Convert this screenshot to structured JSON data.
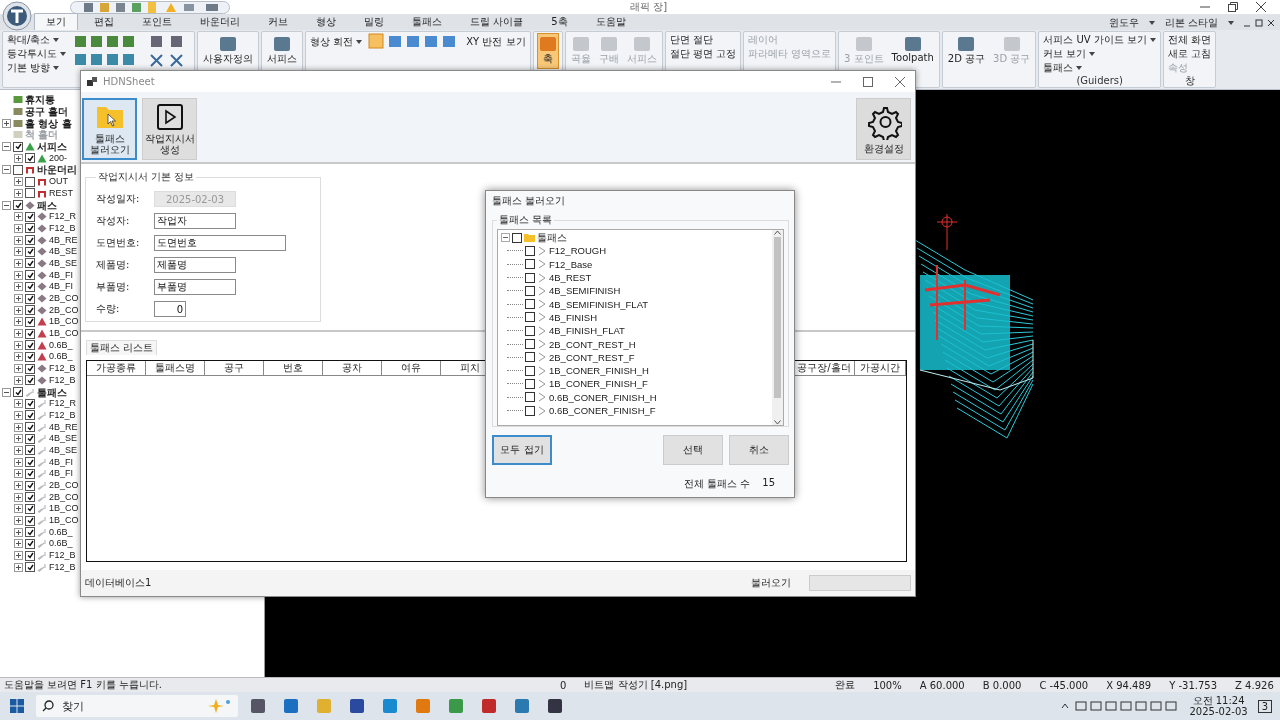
{
  "app": {
    "title_fragment": "래픽 장]"
  },
  "ribbon_tabs": [
    {
      "label": "보기",
      "selected": true
    },
    {
      "label": "편집",
      "selected": false
    },
    {
      "label": "포인트",
      "selected": false
    },
    {
      "label": "바운더리",
      "selected": false
    },
    {
      "label": "커브",
      "selected": false
    },
    {
      "label": "형상",
      "selected": false
    },
    {
      "label": "밀링",
      "selected": false
    },
    {
      "label": "툴패스",
      "selected": false
    },
    {
      "label": "드릴 사이클",
      "selected": false
    },
    {
      "label": "5축",
      "selected": false
    },
    {
      "label": "도움말",
      "selected": false
    }
  ],
  "ribbon_menu": [
    "윈도우",
    "리본 스타일"
  ],
  "ribbon_groups": [
    {
      "kind": "view",
      "items": [
        {
          "label": "확대/축소",
          "dropdown": true,
          "disabled": false
        },
        {
          "label": "등각투시도",
          "dropdown": true,
          "disabled": false
        },
        {
          "label": "기본 방향",
          "dropdown": true,
          "disabled": false
        }
      ]
    },
    {
      "kind": "large",
      "items": [
        {
          "label": "사용자정의",
          "disabled": false,
          "selected": false
        }
      ]
    },
    {
      "kind": "large",
      "items": [
        {
          "label": "서피스",
          "disabled": false,
          "selected": false
        }
      ]
    },
    {
      "kind": "rotate",
      "items": [
        {
          "label": "형상 회전",
          "dropdown": true,
          "disabled": false
        },
        {
          "label": "XY 반전 보기",
          "dropdown": false,
          "disabled": false
        }
      ]
    },
    {
      "kind": "large",
      "items": [
        {
          "label": "축",
          "disabled": false,
          "selected": true
        }
      ]
    },
    {
      "kind": "large",
      "items": [
        {
          "label": "곡율",
          "disabled": true,
          "selected": false
        },
        {
          "label": "구배",
          "disabled": true,
          "selected": false
        },
        {
          "label": "서피스",
          "disabled": true,
          "selected": false
        }
      ]
    },
    {
      "kind": "list",
      "items": [
        {
          "label": "단면 절단",
          "dropdown": false,
          "disabled": false
        },
        {
          "label": "절단 평면 고정",
          "dropdown": false,
          "disabled": false
        }
      ]
    },
    {
      "kind": "list",
      "items": [
        {
          "label": "레이어",
          "dropdown": false,
          "disabled": true
        },
        {
          "label": "파라메타 영역으로",
          "dropdown": false,
          "disabled": true
        }
      ]
    },
    {
      "kind": "large",
      "items": [
        {
          "label": "3 포인트",
          "disabled": true,
          "selected": false
        },
        {
          "label": "Toolpath",
          "disabled": false,
          "selected": false
        }
      ]
    },
    {
      "kind": "large",
      "items": [
        {
          "label": "2D 공구",
          "disabled": false,
          "selected": false
        },
        {
          "label": "3D 공구",
          "disabled": true,
          "selected": false
        }
      ]
    },
    {
      "kind": "list",
      "footer": "(Guiders)",
      "items": [
        {
          "label": "서피스 UV 가이드 보기",
          "dropdown": true,
          "disabled": false
        },
        {
          "label": "커브 보기",
          "dropdown": true,
          "disabled": false
        },
        {
          "label": "툴패스",
          "dropdown": true,
          "disabled": false
        }
      ]
    },
    {
      "kind": "list",
      "footer": "창",
      "items": [
        {
          "label": "전체 화면",
          "dropdown": false,
          "disabled": false
        },
        {
          "label": "새로 고침",
          "dropdown": false,
          "disabled": false
        },
        {
          "label": "속성",
          "dropdown": false,
          "disabled": true
        }
      ]
    }
  ],
  "tree": [
    {
      "label": "휴지통",
      "kind": "trash",
      "disabled": false
    },
    {
      "label": "공구 홀더",
      "kind": "holder",
      "disabled": false
    },
    {
      "label": "홀 형상 홀",
      "kind": "holder",
      "disabled": false,
      "expanded": false
    },
    {
      "label": "척 홀더",
      "kind": "holder",
      "disabled": true
    },
    {
      "label": "서피스",
      "kind": "surface",
      "disabled": false,
      "checked": true,
      "expanded": true,
      "children": [
        {
          "label": "200-",
          "kind": "surface",
          "checked": true,
          "expanded": false
        }
      ]
    },
    {
      "label": "바운더리",
      "kind": "boundary",
      "disabled": false,
      "checked": false,
      "expanded": true,
      "children": [
        {
          "label": "OUT",
          "kind": "boundary",
          "checked": false,
          "expanded": false
        },
        {
          "label": "REST",
          "kind": "boundary",
          "checked": false,
          "expanded": false
        }
      ]
    },
    {
      "label": "패스",
      "kind": "mesh",
      "disabled": false,
      "checked": true,
      "expanded": true,
      "children": [
        {
          "label": "F12_R",
          "kind": "mesh",
          "checked": true,
          "expanded": false
        },
        {
          "label": "F12_B",
          "kind": "mesh",
          "checked": true,
          "expanded": false
        },
        {
          "label": "4B_RE",
          "kind": "mesh",
          "checked": true,
          "expanded": false
        },
        {
          "label": "4B_SE",
          "kind": "mesh",
          "checked": true,
          "expanded": false
        },
        {
          "label": "4B_SE",
          "kind": "mesh",
          "checked": true,
          "expanded": false
        },
        {
          "label": "4B_FI",
          "kind": "mesh",
          "checked": true,
          "expanded": false
        },
        {
          "label": "4B_FI",
          "kind": "mesh",
          "checked": true,
          "expanded": false
        },
        {
          "label": "2B_CO",
          "kind": "mesh",
          "checked": true,
          "expanded": false
        },
        {
          "label": "2B_CO",
          "kind": "mesh",
          "checked": true,
          "expanded": false
        },
        {
          "label": "1B_CO",
          "kind": "cone",
          "checked": true,
          "expanded": false
        },
        {
          "label": "1B_CO",
          "kind": "cone",
          "checked": true,
          "expanded": false
        },
        {
          "label": "0.6B_",
          "kind": "cone",
          "checked": true,
          "expanded": false
        },
        {
          "label": "0.6B_",
          "kind": "cone",
          "checked": true,
          "expanded": false
        },
        {
          "label": "F12_B",
          "kind": "mesh",
          "checked": true,
          "expanded": false
        },
        {
          "label": "F12_B",
          "kind": "mesh",
          "checked": true,
          "expanded": false
        }
      ]
    },
    {
      "label": "툴패스",
      "kind": "toolpath",
      "disabled": false,
      "checked": true,
      "expanded": true,
      "children": [
        {
          "label": "F12_R",
          "kind": "toolpath",
          "checked": true,
          "expanded": false
        },
        {
          "label": "F12_B",
          "kind": "toolpath",
          "checked": true,
          "expanded": false
        },
        {
          "label": "4B_RE",
          "kind": "toolpath",
          "checked": true,
          "expanded": false
        },
        {
          "label": "4B_SE",
          "kind": "toolpath",
          "checked": true,
          "expanded": false
        },
        {
          "label": "4B_SE",
          "kind": "toolpath",
          "checked": true,
          "expanded": false
        },
        {
          "label": "4B_FI",
          "kind": "toolpath",
          "checked": true,
          "expanded": false
        },
        {
          "label": "4B_FI",
          "kind": "toolpath",
          "checked": true,
          "expanded": false
        },
        {
          "label": "2B_CO",
          "kind": "toolpath",
          "checked": true,
          "expanded": false
        },
        {
          "label": "2B_CO",
          "kind": "toolpath",
          "checked": true,
          "expanded": false
        },
        {
          "label": "1B_CO",
          "kind": "toolpath",
          "checked": true,
          "expanded": false
        },
        {
          "label": "1B_CO",
          "kind": "toolpath",
          "checked": true,
          "expanded": false
        },
        {
          "label": "0.6B_",
          "kind": "toolpath",
          "checked": true,
          "expanded": false
        },
        {
          "label": "0.6B_",
          "kind": "toolpath",
          "checked": true,
          "expanded": false
        },
        {
          "label": "F12_B",
          "kind": "toolpath",
          "checked": true,
          "expanded": false
        },
        {
          "label": "F12_B",
          "kind": "toolpath",
          "checked": true,
          "expanded": false
        }
      ]
    }
  ],
  "hdn": {
    "title": "HDNSheet",
    "toolbar": [
      {
        "label": "툴패스\n불러오기",
        "kind": "folder",
        "selected": true
      },
      {
        "label": "작업지시서\n생성",
        "kind": "play",
        "selected": false
      }
    ],
    "settings_button": "환경설정",
    "info_legend": "작업지시서 기본 정보",
    "fields": [
      {
        "label": "작성일자:",
        "value": "2025-02-03",
        "kind": "date",
        "disabled": true
      },
      {
        "label": "작성자:",
        "value": "작업자",
        "kind": "text",
        "disabled": false
      },
      {
        "label": "도면번호:",
        "value": "도면번호",
        "kind": "wide",
        "disabled": false
      },
      {
        "label": "제품명:",
        "value": "제품명",
        "kind": "text",
        "disabled": false
      },
      {
        "label": "부품명:",
        "value": "부품명",
        "kind": "text",
        "disabled": false
      },
      {
        "label": "수량:",
        "value": "0",
        "kind": "number",
        "disabled": false
      }
    ],
    "list_tab": "툴패스 리스트",
    "columns_left": [
      "가공종류",
      "툴패스명",
      "공구",
      "번호",
      "공차",
      "여유",
      "피치"
    ],
    "columns_right": [
      "공구장/홀더",
      "가공시간"
    ],
    "status_left": "데이터베이스1",
    "progress": {
      "label": "불러오기",
      "level": 0
    }
  },
  "dialog": {
    "title": "툴패스 불러오기",
    "legend": "툴패스 목록",
    "root": {
      "label": "툴패스",
      "checked": false,
      "expanded": true,
      "children": [
        {
          "label": "F12_ROUGH",
          "checked": false
        },
        {
          "label": "F12_Base",
          "checked": false
        },
        {
          "label": "4B_REST",
          "checked": false
        },
        {
          "label": "4B_SEMIFINISH",
          "checked": false
        },
        {
          "label": "4B_SEMIFINISH_FLAT",
          "checked": false
        },
        {
          "label": "4B_FINISH",
          "checked": false
        },
        {
          "label": "4B_FINISH_FLAT",
          "checked": false
        },
        {
          "label": "2B_CONT_REST_H",
          "checked": false
        },
        {
          "label": "2B_CONT_REST_F",
          "checked": false
        },
        {
          "label": "1B_CONER_FINISH_H",
          "checked": false
        },
        {
          "label": "1B_CONER_FINISH_F",
          "checked": false
        },
        {
          "label": "0.6B_CONER_FINISH_H",
          "checked": false
        },
        {
          "label": "0.6B_CONER_FINISH_F",
          "checked": false
        }
      ]
    },
    "buttons": [
      {
        "label": "모두 접기",
        "focused": true
      },
      {
        "label": "선택",
        "focused": false
      },
      {
        "label": "취소",
        "focused": false
      }
    ],
    "count_label": "전체 툴패스 수",
    "count": "15"
  },
  "status_bar": [
    "도움말을 보려면 F1 키를 누릅니다.",
    "0",
    "비트맵 작성기 [4.png]",
    "완료",
    "100%",
    "A 60.000",
    "B 0.000",
    "C -45.000",
    "X 94.489",
    "Y -31.753",
    "Z 4.926"
  ],
  "taskbar": {
    "search": "찾기",
    "time": "오전 11:24",
    "date": "2025-02-03",
    "notifications": "3"
  }
}
